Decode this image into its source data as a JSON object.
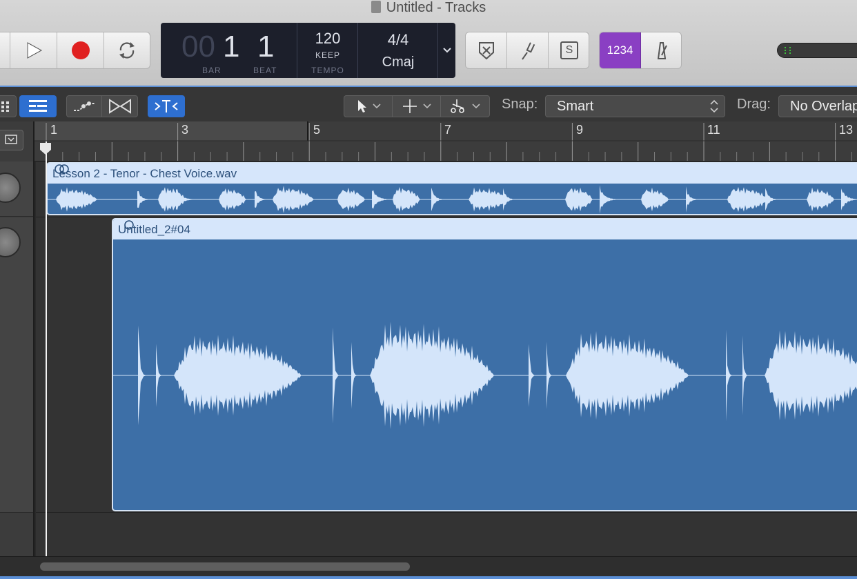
{
  "window": {
    "title": "Untitled - Tracks"
  },
  "lcd": {
    "bar_dim": "00",
    "bar": "1",
    "beat": "1",
    "bar_label": "BAR",
    "beat_label": "BEAT",
    "tempo": "120",
    "tempo_mode": "KEEP",
    "tempo_label": "TEMPO",
    "time_signature": "4/4",
    "key": "Cmaj"
  },
  "count_in_label": "1234",
  "solo_label": "S",
  "toolbar": {
    "snap_label": "Snap:",
    "snap_value": "Smart",
    "drag_label": "Drag:",
    "drag_value": "No Overlap"
  },
  "ruler": {
    "bars": [
      "1",
      "3",
      "5",
      "7",
      "9",
      "11",
      "13"
    ]
  },
  "regions": [
    {
      "name": "Lesson 2 - Tenor - Chest Voice.wav"
    },
    {
      "name": "Untitled_2#04"
    }
  ],
  "colors": {
    "region_fill": "#3d6fa7",
    "region_header": "#d6e6fb",
    "waveform": "#d4e5fa",
    "accent": "#5b8fd6",
    "count_in": "#8a3fc3",
    "record": "#e02020"
  }
}
